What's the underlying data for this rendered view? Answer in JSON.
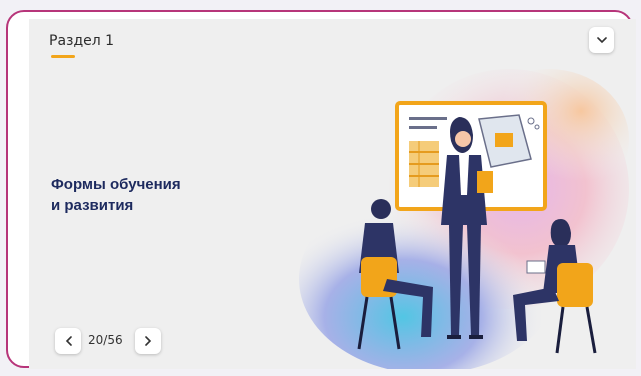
{
  "section": {
    "label": "Раздел 1"
  },
  "slide": {
    "title_line1": "Формы обучения",
    "title_line2": "и развития"
  },
  "pagination": {
    "counter": "20/56"
  },
  "icons": {
    "collapse": "chevron-down-icon",
    "prev": "chevron-left-icon",
    "next": "chevron-right-icon"
  },
  "colors": {
    "accent_underline": "#f2a51a",
    "frame_border": "#b7357a",
    "title": "#1d2a5e"
  }
}
